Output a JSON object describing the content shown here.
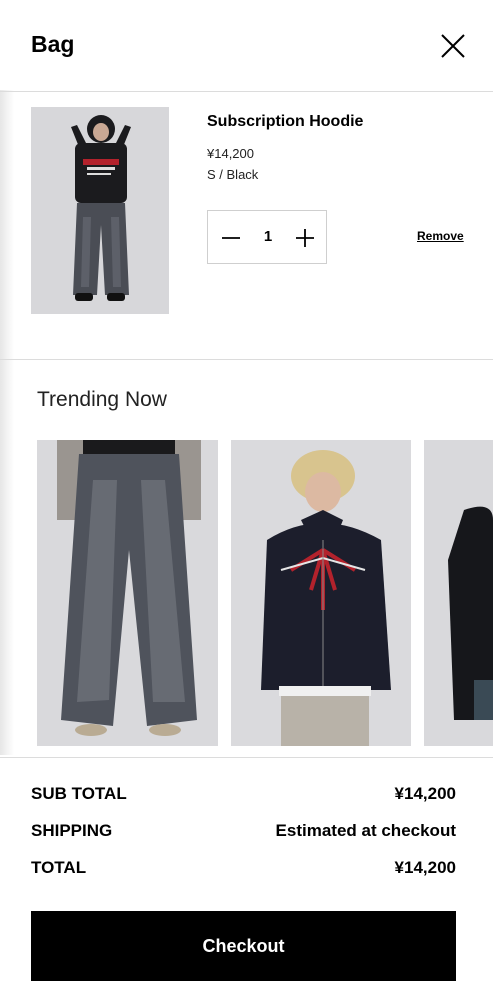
{
  "header": {
    "title": "Bag",
    "close_icon": "close-icon"
  },
  "cart_item": {
    "name": "Subscription Hoodie",
    "price": "¥14,200",
    "variant": "S / Black",
    "quantity": "1",
    "remove_label": "Remove"
  },
  "trending": {
    "title": "Trending Now",
    "products": [
      {
        "image": "grey-wash-wide-jeans"
      },
      {
        "image": "black-graphic-zip-hoodie"
      },
      {
        "image": "black-hoodie-partial"
      }
    ]
  },
  "summary": {
    "subtotal_label": "SUB TOTAL",
    "subtotal_value": "¥14,200",
    "shipping_label": "SHIPPING",
    "shipping_value": "Estimated at checkout",
    "total_label": "TOTAL",
    "total_value": "¥14,200"
  },
  "checkout_label": "Checkout"
}
